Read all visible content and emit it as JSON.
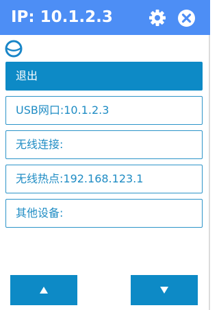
{
  "window": {
    "title": "IP: 10.1.2.3",
    "accent_color": "#4d8ef5"
  },
  "header": {
    "settings_icon": "gear-icon",
    "close_icon": "close-icon",
    "logo_icon": "ring-logo-icon"
  },
  "menu": {
    "items": [
      {
        "label": "退出"
      },
      {
        "label": "USB网口:10.1.2.3"
      },
      {
        "label": "无线连接:"
      },
      {
        "label": "无线热点:192.168.123.1"
      },
      {
        "label": "其他设备:"
      }
    ],
    "primary_color": "#0d8ac6",
    "text_color": "#1f8cc4"
  },
  "nav": {
    "up_icon": "triangle-up-icon",
    "down_icon": "triangle-down-icon"
  }
}
